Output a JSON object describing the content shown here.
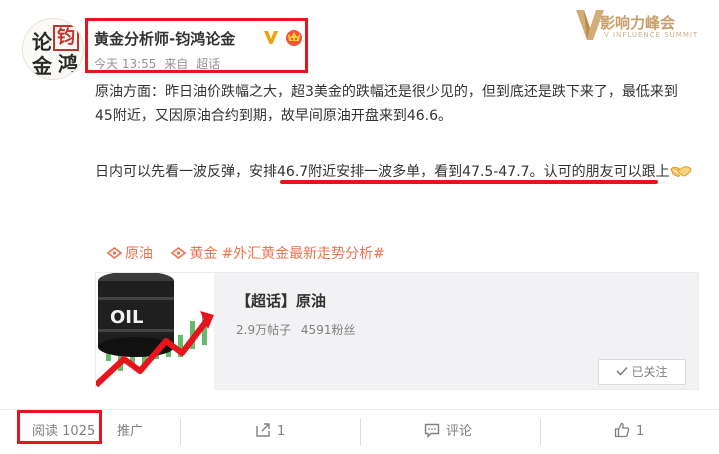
{
  "post": {
    "author": "黄金分析师-钧鸿论金",
    "meta": {
      "time": "今天 13:55",
      "source_prefix": "来自",
      "source": "超话"
    },
    "avatar_chars": [
      "论",
      "钧",
      "金",
      "鸿"
    ],
    "paragraph1": "原油方面：昨日油价跌幅之大，超3美金的跌幅还是很少见的，但到底还是跌下来了，最低来到45附近，又因原油合约到期，故早间原油开盘来到46.6。",
    "paragraph2_start": "日内可以先看一波反弹，",
    "paragraph2_highlight": "安排46.7附近安排一波多单，看到47.5-47.7。",
    "paragraph2_end": "认可的朋友可以跟上",
    "topics": [
      "原油",
      "黄金",
      "#外汇黄金最新走势分析#"
    ]
  },
  "brand": {
    "logo_text": "影响力峰会",
    "logo_sub": "V INFLUENCE SUMMIT"
  },
  "link_card": {
    "title": "【超话】原油",
    "posts": "2.9万帖子",
    "fans": "4591粉丝",
    "thumb_text": "OIL",
    "follow_label": "已关注"
  },
  "actions": {
    "read_label": "阅读",
    "read_count": "1025",
    "promote": "推广",
    "repost_count": "1",
    "comment": "评论",
    "like_count": "1"
  },
  "colors": {
    "highlight_red": "#e8141b",
    "topic_orange": "#eb7350",
    "text": "#333333",
    "muted": "#939393",
    "brand_gold": "#c89f6a"
  },
  "icons": {
    "verified": "verified-v-icon",
    "vip": "vip-crown-icon",
    "topic": "topic-tag-icon",
    "handshake": "handshake-emoji-icon",
    "repost": "repost-icon",
    "comment": "comment-icon",
    "like": "thumbs-up-icon",
    "check": "check-icon"
  }
}
